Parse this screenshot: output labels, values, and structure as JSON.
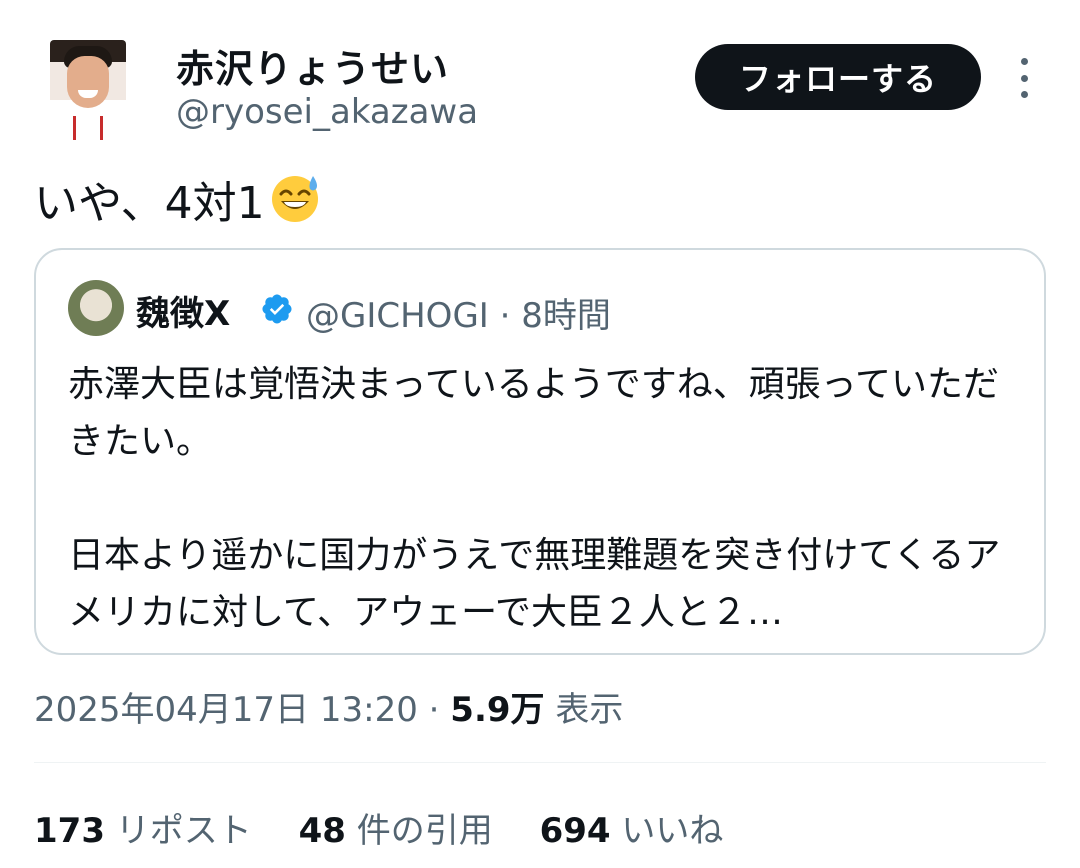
{
  "author": {
    "display_name": "赤沢りょうせい",
    "handle": "@ryosei_akazawa"
  },
  "follow_button": {
    "label": "フォローする"
  },
  "tweet": {
    "text": "いや、4対1",
    "emoji": "sweat-smile-emoji"
  },
  "quoted_tweet": {
    "name": "魏徴X",
    "verified": true,
    "handle_time": "@GICHOGI · 8時間",
    "body": "赤澤大臣は覚悟決まっているようですね、頑張っていただきたい。\n\n日本より遥かに国力がうえで無理難題を突き付けてくるアメリカに対して、アウェーで大臣２人と２…"
  },
  "meta": {
    "timestamp": "2025年04月17日 13:20 · ",
    "views_count": "5.9万",
    "views_label": "表示"
  },
  "stats": {
    "reposts_count": "173",
    "reposts_label": "リポスト",
    "quotes_count": "48",
    "quotes_label": "件の引用",
    "likes_count": "694",
    "likes_label": "いいね"
  },
  "colors": {
    "text_primary": "#0f1419",
    "text_secondary": "#536471",
    "border": "#cfd9de",
    "verified_blue": "#1d9bf0"
  }
}
